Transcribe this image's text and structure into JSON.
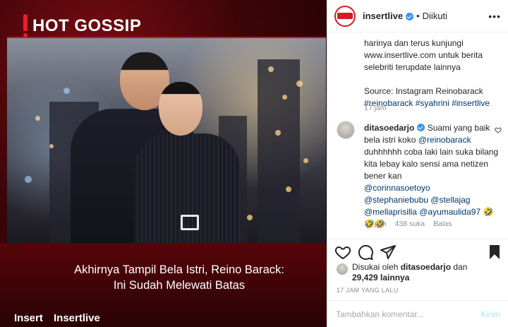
{
  "post_image": {
    "tag": "HOT GOSSIP",
    "headline": "Akhirnya Tampil Bela Istri, Reino Barack: Ini Sudah Melewati Batas",
    "brand_left": "Insert",
    "brand_right": "Insertlive"
  },
  "header": {
    "username": "insertlive",
    "separator": "•",
    "follow_status": "Diikuti",
    "more": "•••"
  },
  "caption": {
    "line1": "harinya dan terus kunjungi",
    "line2": "www.insertlive.com untuk berita",
    "line3": "selebriti terupdate lainnya",
    "source": "Source: Instagram Reinobarack",
    "hashtags": "#reinobarack #syahrini #insertlive",
    "time": "17 jam"
  },
  "comment": {
    "username": "ditasoedarjo",
    "text_part1": "Suami yang baik bela istri koko",
    "mention1": "@reinobarack",
    "text_part2": "duhhhhhh coba laki lain suka bilang kita lebay kalo sensi ama netizen bener kan",
    "mention2": "@corinnasoetoyo",
    "mention3": "@stephaniebubu",
    "mention4": "@stellajag",
    "mention5": "@mellaprisilla",
    "mention6": "@ayumaulida97",
    "emoji1": "🤣",
    "emoji2": "🤣🤣",
    "time": "17 jam",
    "likes": "438 suka",
    "reply": "Balas"
  },
  "likes": {
    "prefix": "Disukai oleh",
    "user": "ditasoedarjo",
    "connector": "dan",
    "count": "29,429 lainnya"
  },
  "post_time": "17 JAM YANG LALU",
  "add_comment": {
    "placeholder": "Tambahkan komentar...",
    "send_label": "Kirim"
  },
  "colors": {
    "accent_red": "#d81b23",
    "link_blue": "#00376b",
    "verified_blue": "#3897f0"
  }
}
